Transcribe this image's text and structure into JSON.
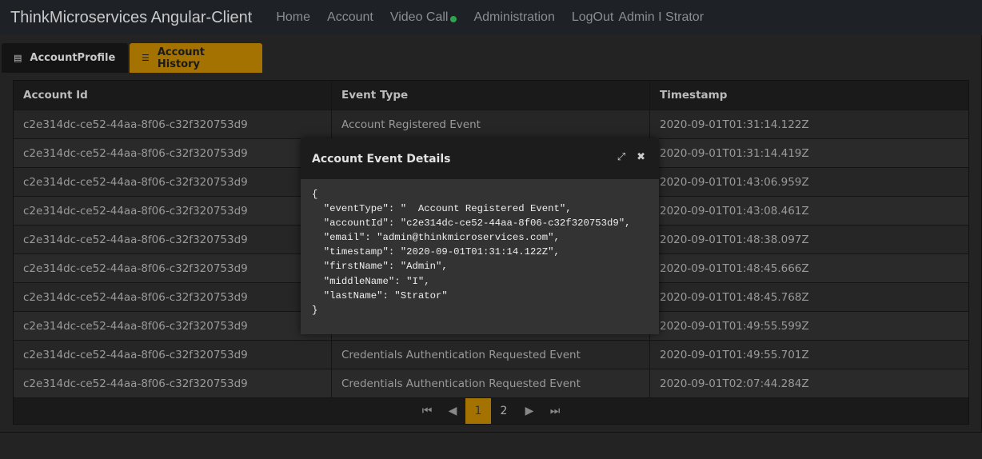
{
  "nav": {
    "brand": "ThinkMicroservices Angular-Client",
    "items": [
      "Home",
      "Account",
      "Video Call",
      "Administration",
      "LogOut"
    ],
    "user": "Admin I Strator"
  },
  "tabs": [
    {
      "label": "AccountProfile",
      "icon": "id-card-icon"
    },
    {
      "label": "Account History",
      "icon": "list-icon",
      "active": true
    }
  ],
  "table": {
    "headers": [
      "Account Id",
      "Event Type",
      "Timestamp"
    ],
    "rows": [
      [
        "c2e314dc-ce52-44aa-8f06-c32f320753d9",
        "Account Registered Event",
        "2020-09-01T01:31:14.122Z"
      ],
      [
        "c2e314dc-ce52-44aa-8f06-c32f320753d9",
        "",
        "2020-09-01T01:31:14.419Z"
      ],
      [
        "c2e314dc-ce52-44aa-8f06-c32f320753d9",
        "",
        "2020-09-01T01:43:06.959Z"
      ],
      [
        "c2e314dc-ce52-44aa-8f06-c32f320753d9",
        "",
        "2020-09-01T01:43:08.461Z"
      ],
      [
        "c2e314dc-ce52-44aa-8f06-c32f320753d9",
        "",
        "2020-09-01T01:48:38.097Z"
      ],
      [
        "c2e314dc-ce52-44aa-8f06-c32f320753d9",
        "",
        "2020-09-01T01:48:45.666Z"
      ],
      [
        "c2e314dc-ce52-44aa-8f06-c32f320753d9",
        "",
        "2020-09-01T01:48:45.768Z"
      ],
      [
        "c2e314dc-ce52-44aa-8f06-c32f320753d9",
        "",
        "2020-09-01T01:49:55.599Z"
      ],
      [
        "c2e314dc-ce52-44aa-8f06-c32f320753d9",
        "Credentials Authentication Requested Event",
        "2020-09-01T01:49:55.701Z"
      ],
      [
        "c2e314dc-ce52-44aa-8f06-c32f320753d9",
        "Credentials Authentication Requested Event",
        "2020-09-01T02:07:44.284Z"
      ]
    ]
  },
  "pager": {
    "pages": [
      "1",
      "2"
    ],
    "current": "1"
  },
  "modal": {
    "title": "Account Event Details",
    "json": "{\n  \"eventType\": \"  Account Registered Event\",\n  \"accountId\": \"c2e314dc-ce52-44aa-8f06-c32f320753d9\",\n  \"email\": \"admin@thinkmicroservices.com\",\n  \"timestamp\": \"2020-09-01T01:31:14.122Z\",\n  \"firstName\": \"Admin\",\n  \"middleName\": \"I\",\n  \"lastName\": \"Strator\"\n}"
  },
  "colors": {
    "accent": "#a37200",
    "navbar": "#1e2227",
    "online": "#2ea44f"
  }
}
